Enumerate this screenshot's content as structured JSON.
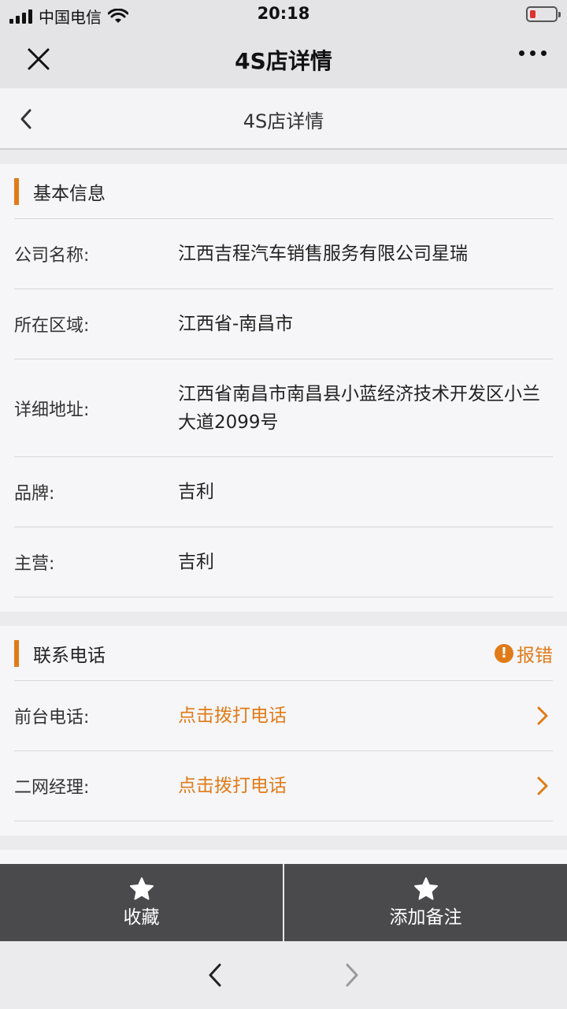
{
  "status_bar": {
    "carrier": "中国电信",
    "time": "20:18"
  },
  "top_nav": {
    "title": "4S店详情"
  },
  "page_header": {
    "title": "4S店详情"
  },
  "basic_info": {
    "title": "基本信息",
    "rows": [
      {
        "label": "公司名称:",
        "value": "江西吉程汽车销售服务有限公司星瑞"
      },
      {
        "label": "所在区域:",
        "value": "江西省-南昌市"
      },
      {
        "label": "详细地址:",
        "value": "江西省南昌市南昌县小蓝经济技术开发区小兰大道2099号"
      },
      {
        "label": "品牌:",
        "value": "吉利"
      },
      {
        "label": "主营:",
        "value": "吉利"
      }
    ]
  },
  "contact": {
    "title": "联系电话",
    "report_label": "报错",
    "rows": [
      {
        "label": "前台电话:",
        "value": "点击拨打电话"
      },
      {
        "label": "二网经理:",
        "value": "点击拨打电话"
      }
    ]
  },
  "actions": {
    "favorite_label": "收藏",
    "note_label": "添加备注"
  },
  "colors": {
    "accent": "#e07b18",
    "action_bar": "#4a4a4c"
  }
}
